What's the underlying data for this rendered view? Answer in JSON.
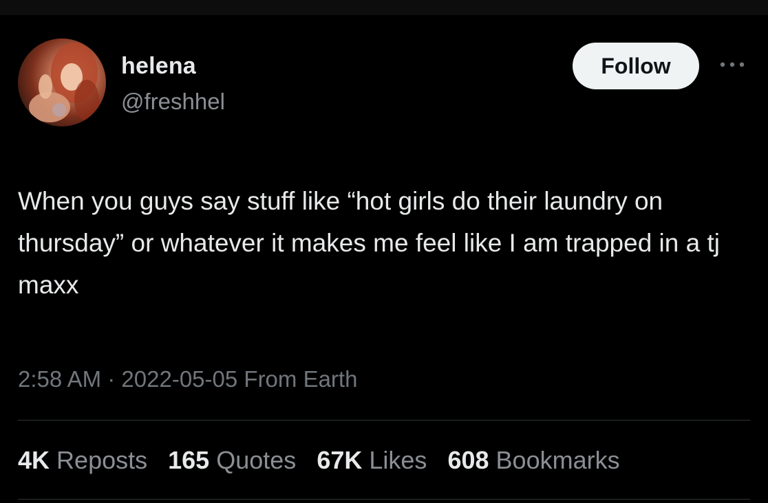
{
  "user": {
    "display_name": "helena",
    "handle": "@freshhel",
    "follow_label": "Follow"
  },
  "tweet": {
    "text": "When you guys say stuff like “hot girls do their laundry on thursday” or whatever it makes me feel like I am trapped in a tj maxx",
    "time": "2:58 AM",
    "separator": "·",
    "date": "2022-05-05",
    "source": "From Earth"
  },
  "stats": [
    {
      "count": "4K",
      "label": "Reposts"
    },
    {
      "count": "165",
      "label": "Quotes"
    },
    {
      "count": "67K",
      "label": "Likes"
    },
    {
      "count": "608",
      "label": "Bookmarks"
    }
  ],
  "icons": {
    "more": "more-horizontal-icon"
  },
  "colors": {
    "background": "#000000",
    "primary_text": "#e7e9ea",
    "secondary_text": "#71767b",
    "follow_button_bg": "#eff3f4",
    "divider": "#2f3336"
  }
}
